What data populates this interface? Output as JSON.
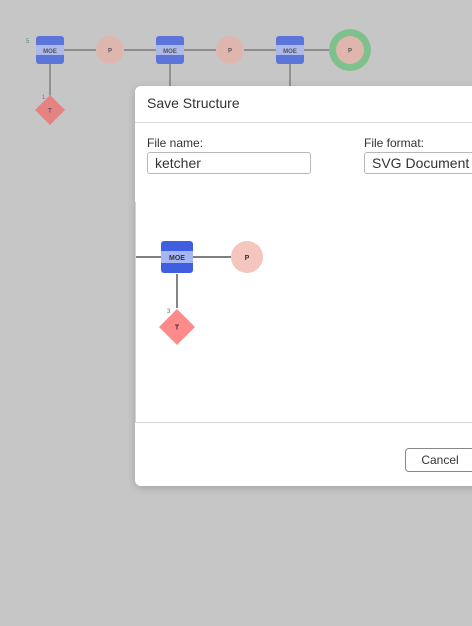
{
  "background": {
    "monomers": {
      "moe": "MOE",
      "p": "P",
      "t": "T"
    },
    "attachment_numbers": [
      "5",
      "1"
    ]
  },
  "dialog": {
    "title": "Save Structure",
    "file_name_label": "File name:",
    "file_name_value": "ketcher",
    "file_format_label": "File format:",
    "file_format_value": "SVG Document",
    "preview": {
      "moe": "MOE",
      "p": "P",
      "t": "T",
      "attachment_number": "3"
    },
    "cancel_label": "Cancel"
  },
  "colors": {
    "moe_fill": "#3f5fe0",
    "moe_band": "#a6b6f4",
    "p_fill": "#f5c6bd",
    "t_fill": "#ff8a8a",
    "selection_ring": "#6cc07e"
  }
}
